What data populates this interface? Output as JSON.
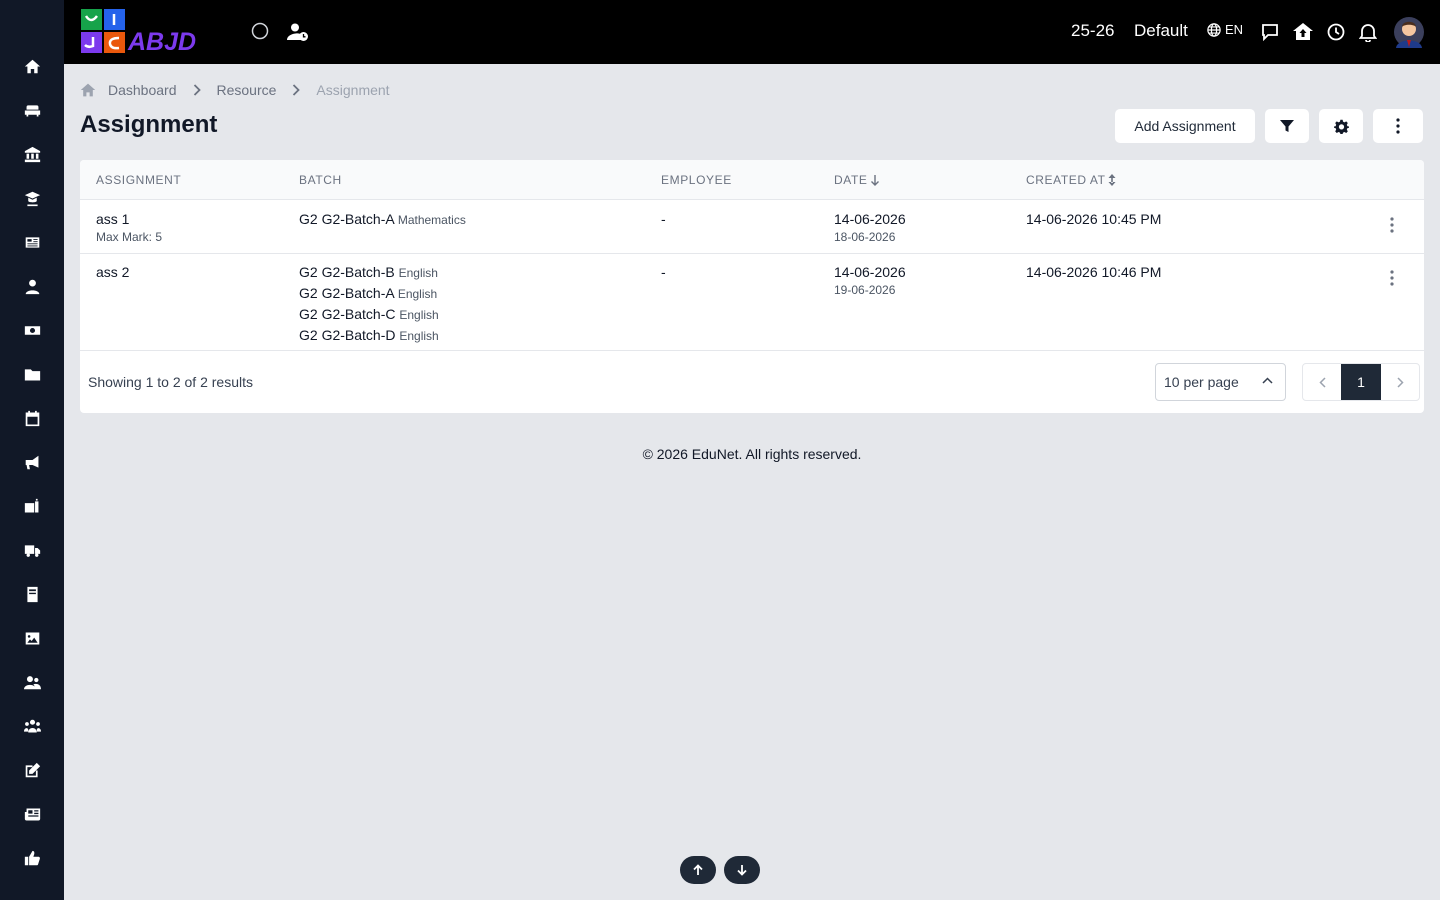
{
  "app": {
    "logo_text": "ABJD",
    "session": "25-26",
    "profile": "Default",
    "language": "EN"
  },
  "sidebar": {
    "items": [
      {
        "icon": "home-icon"
      },
      {
        "icon": "sofa-icon"
      },
      {
        "icon": "bank-icon"
      },
      {
        "icon": "graduation-icon"
      },
      {
        "icon": "newspaper-icon"
      },
      {
        "icon": "person-icon"
      },
      {
        "icon": "money-icon"
      },
      {
        "icon": "folder-icon"
      },
      {
        "icon": "calendar-icon"
      },
      {
        "icon": "megaphone-icon"
      },
      {
        "icon": "sign-icon"
      },
      {
        "icon": "truck-icon"
      },
      {
        "icon": "book-icon"
      },
      {
        "icon": "image-icon"
      },
      {
        "icon": "users-icon"
      },
      {
        "icon": "group-icon"
      },
      {
        "icon": "edit-icon"
      },
      {
        "icon": "news-icon"
      },
      {
        "icon": "thumbs-up-icon"
      }
    ]
  },
  "breadcrumb": {
    "items": [
      "Dashboard",
      "Resource",
      "Assignment"
    ]
  },
  "page": {
    "title": "Assignment",
    "add_button": "Add Assignment"
  },
  "table": {
    "headers": {
      "assignment": "ASSIGNMENT",
      "batch": "BATCH",
      "employee": "EMPLOYEE",
      "date": "DATE",
      "created_at": "CREATED AT"
    },
    "rows": [
      {
        "title": "ass 1",
        "max_mark": "Max Mark: 5",
        "batches": [
          {
            "name": "G2 G2-Batch-A",
            "subject": "Mathematics"
          }
        ],
        "employee": "-",
        "date": "14-06-2026",
        "due_date": "18-06-2026",
        "created_at": "14-06-2026 10:45 PM"
      },
      {
        "title": "ass 2",
        "batches": [
          {
            "name": "G2 G2-Batch-B",
            "subject": "English"
          },
          {
            "name": "G2 G2-Batch-A",
            "subject": "English"
          },
          {
            "name": "G2 G2-Batch-C",
            "subject": "English"
          },
          {
            "name": "G2 G2-Batch-D",
            "subject": "English"
          }
        ],
        "employee": "-",
        "date": "14-06-2026",
        "due_date": "19-06-2026",
        "created_at": "14-06-2026 10:46 PM"
      }
    ]
  },
  "pagination": {
    "summary": "Showing 1 to 2 of 2 results",
    "per_page": "10 per page",
    "current_page": "1"
  },
  "footer": {
    "copyright": "© 2026 EduNet. All rights reserved."
  }
}
